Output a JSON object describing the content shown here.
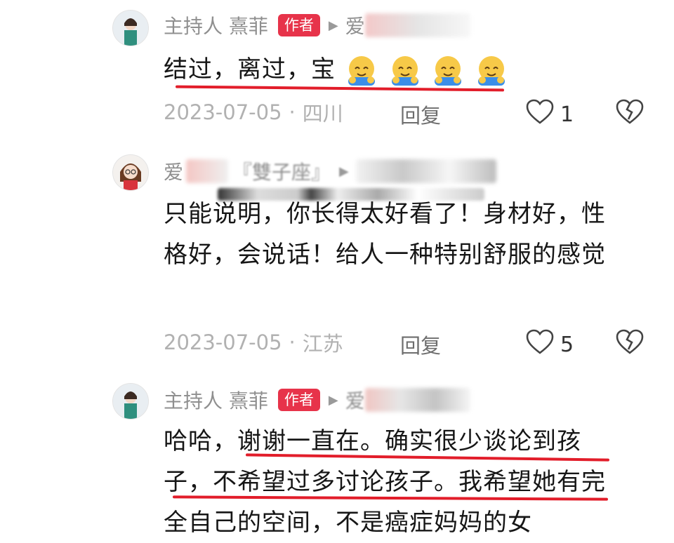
{
  "comments": [
    {
      "author": "主持人 熹菲",
      "author_tag": "作者",
      "reply_to_prefix": "爱",
      "text": "结过，离过，宝",
      "emoji_name": "hugging-face-emoji",
      "emoji_count": 4,
      "date": "2023-07-05",
      "location": "四川",
      "reply_label": "回复",
      "likes": "1"
    },
    {
      "author_prefix": "爱",
      "author_hint": "『雙子座』",
      "text": "只能说明，你长得太好看了！身材好，性格好，会说话！给人一种特别舒服的感觉",
      "date": "2023-07-05",
      "location": "江苏",
      "reply_label": "回复",
      "likes": "5"
    },
    {
      "author": "主持人 熹菲",
      "author_tag": "作者",
      "reply_to_prefix": "爱",
      "text": "哈哈，谢谢一直在。确实很少谈论到孩子，不希望过多讨论孩子。我希望她有完全自己的空间，不是癌症妈妈的女"
    }
  ],
  "colors": {
    "tag_bg": "#e7334a",
    "underline": "#e21d2a",
    "meta_text": "#b1b1b1"
  },
  "icons": {
    "like": "heart-outline-icon",
    "dislike": "broken-heart-icon",
    "reply_arrow": "triangle-right-icon"
  }
}
